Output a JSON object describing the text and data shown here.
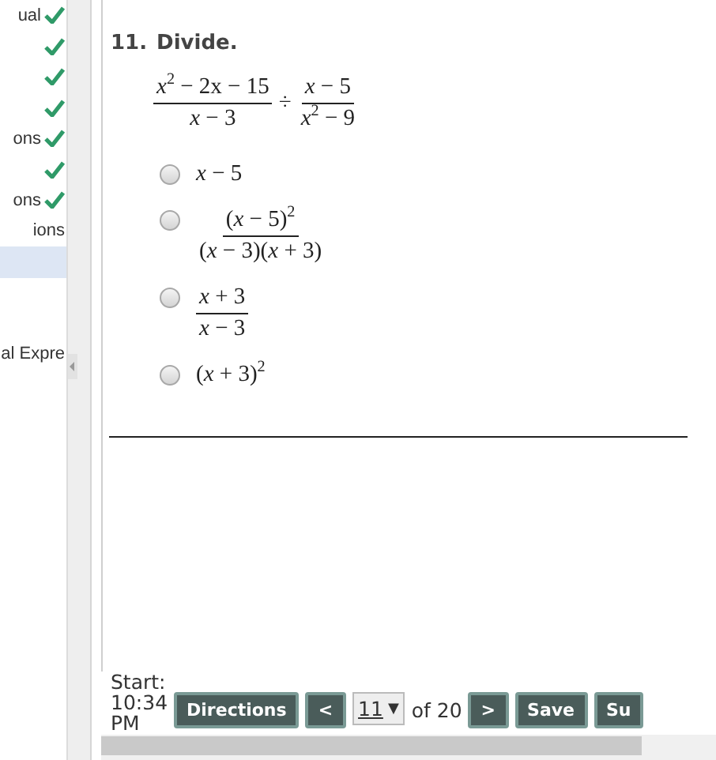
{
  "sidebar": {
    "items": [
      {
        "label": "ual",
        "checked": true,
        "selected": false
      },
      {
        "checked": true,
        "selected": false
      },
      {
        "checked": true,
        "selected": false
      },
      {
        "checked": true,
        "selected": false
      },
      {
        "label": "ons",
        "checked": true,
        "selected": false
      },
      {
        "checked": true,
        "selected": false
      },
      {
        "label": "ons",
        "checked": true,
        "selected": false
      },
      {
        "label": "ions",
        "checked": false,
        "selected": false
      },
      {
        "checked": false,
        "selected": true
      },
      {
        "checked": false,
        "selected": false
      },
      {
        "checked": false,
        "selected": false
      },
      {
        "label": "al Expre",
        "checked": false,
        "selected": false
      }
    ]
  },
  "question": {
    "number": "11.",
    "prompt": "Divide.",
    "expression": {
      "left": {
        "num": "*x*$^{2}$ − 2x − 15",
        "den": "*x* − 3"
      },
      "operator": "÷",
      "right": {
        "num": "*x* − 5",
        "den": "*x*$^{2}$ − 9"
      }
    },
    "options": [
      {
        "kind": "plain",
        "text": "*x* − 5",
        "selected": false
      },
      {
        "kind": "fraction",
        "num": "(*x* − 5)$^{2}$",
        "den": "(*x* − 3)(*x* + 3)",
        "selected": false
      },
      {
        "kind": "fraction",
        "num": "*x* + 3",
        "den": "*x* − 3",
        "selected": false
      },
      {
        "kind": "plain",
        "text": "(*x* + 3)$^{2}$",
        "selected": false
      }
    ]
  },
  "footer": {
    "start_label": "Start:",
    "start_time": "10:34",
    "start_period": "PM",
    "buttons": [
      {
        "kind": "button",
        "label": "Directions"
      },
      {
        "kind": "button",
        "label": "<"
      },
      {
        "kind": "select",
        "value": "11",
        "caret": "▼"
      },
      {
        "kind": "text",
        "label": "of 20"
      },
      {
        "kind": "button",
        "label": ">"
      },
      {
        "kind": "button",
        "label": "Save"
      },
      {
        "kind": "button",
        "label": "Su"
      }
    ]
  }
}
